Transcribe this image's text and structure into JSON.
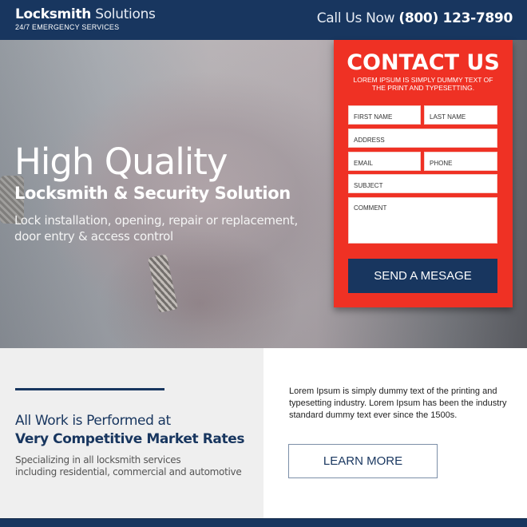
{
  "header": {
    "brand_bold": "Locksmith",
    "brand_light": "Solutions",
    "tagline": "24/7 EMERGENCY SERVICES",
    "call_label": "Call Us Now",
    "phone": "(800) 123-7890"
  },
  "hero": {
    "title": "High Quality",
    "subtitle": "Locksmith & Security Solution",
    "description_line1": "Lock installation, opening, repair or replacement,",
    "description_line2": "door entry & access control"
  },
  "contact_form": {
    "title": "CONTACT US",
    "subtitle": "LOREM IPSUM IS SIMPLY DUMMY TEXT OF THE PRINT AND TYPESETTING.",
    "fields": {
      "first_name": "FIRST NAME",
      "last_name": "LAST NAME",
      "address": "ADDRESS",
      "email": "EMAIL",
      "phone": "PHONE",
      "subject": "SUBJECT",
      "comment": "COMMENT"
    },
    "submit_label": "SEND A MESAGE"
  },
  "rates_section": {
    "heading_line1": "All Work is Performed at",
    "heading_line2": "Very Competitive Market Rates",
    "text_line1": "Specializing in all locksmith services",
    "text_line2": "including residential, commercial and automotive"
  },
  "info_section": {
    "text": "Lorem Ipsum is simply dummy text of the printing and typesetting industry. Lorem Ipsum has been the industry standard dummy text ever since the 1500s.",
    "button_label": "LEARN MORE"
  },
  "colors": {
    "navy": "#18365f",
    "red": "#ef3124",
    "light_gray": "#efefef"
  }
}
